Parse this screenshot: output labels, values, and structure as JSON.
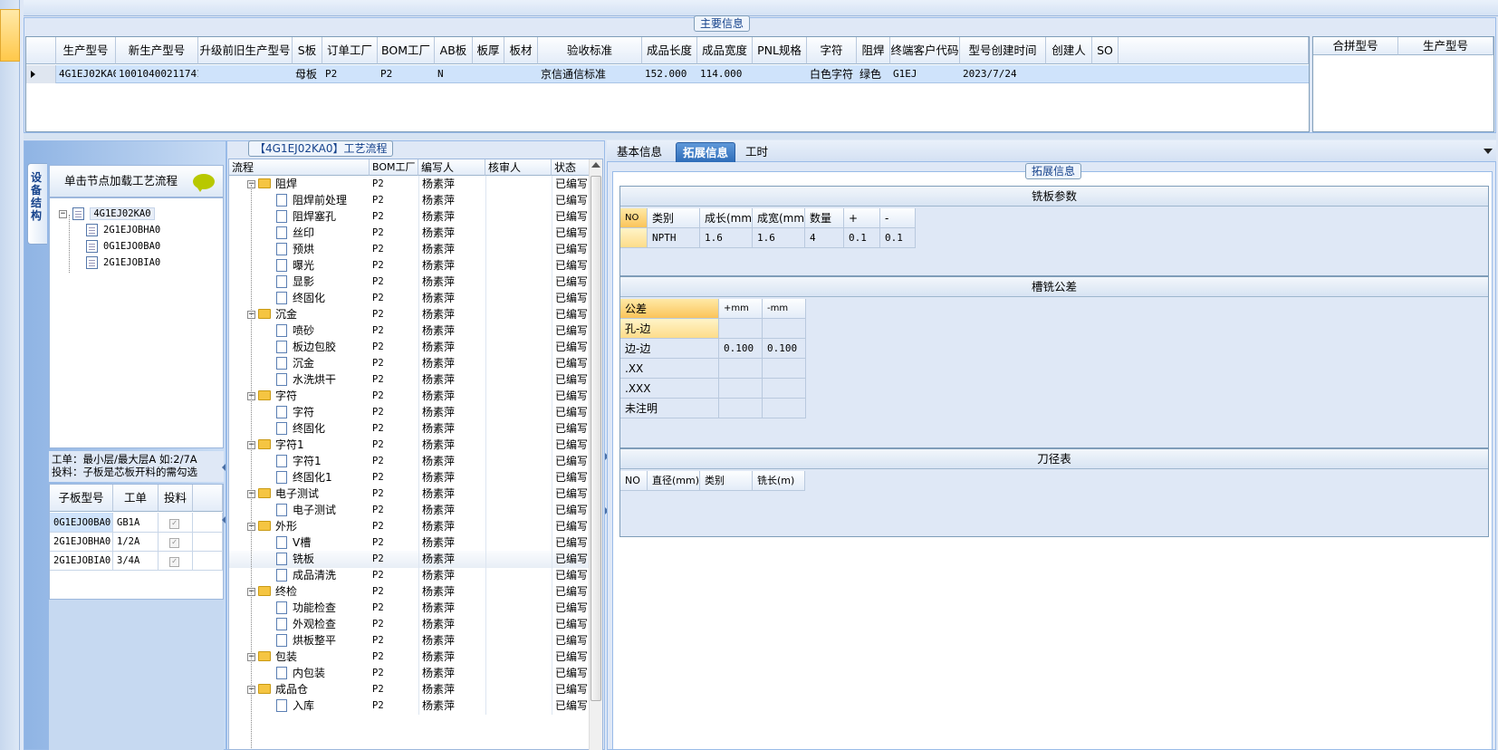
{
  "main_info": {
    "title": "主要信息",
    "columns": [
      "生产型号",
      "新生产型号",
      "升级前旧生产型号",
      "S板",
      "订单工厂",
      "BOM工厂",
      "AB板",
      "板厚",
      "板材",
      "验收标准",
      "成品长度",
      "成品宽度",
      "PNL规格",
      "字符",
      "阻焊",
      "终端客户代码",
      "型号创建时间",
      "创建人",
      "SO"
    ],
    "row": {
      "生产型号": "4G1EJ02KA0",
      "新生产型号": "10010400211741",
      "升级前旧生产型号": "",
      "S板": "母板",
      "订单工厂": "P2",
      "BOM工厂": "P2",
      "AB板": "N",
      "板厚": "",
      "板材": "",
      "验收标准": "京信通信标准",
      "成品长度": "152.000",
      "成品宽度": "114.000",
      "PNL规格": "",
      "字符": "白色字符",
      "阻焊": "绿色",
      "终端客户代码": "G1EJ",
      "型号创建时间": "2023/7/24",
      "创建人": "",
      "SO": ""
    },
    "right_columns": [
      "合拼型号",
      "生产型号"
    ]
  },
  "process_panel": {
    "title": "【4G1EJ02KA0】工艺流程",
    "vertical_tab": "设备结构",
    "tree_header": "单击节点加载工艺流程",
    "tree": {
      "root": "4G1EJ02KA0",
      "children": [
        "2G1EJOBHA0",
        "0G1EJO0BA0",
        "2G1EJOBIA0"
      ]
    },
    "notes": [
      "工单：最小层/最大层A 如:2/7A",
      "投料：子板是芯板开料的需勾选"
    ],
    "sub_columns": [
      "子板型号",
      "工单",
      "投料"
    ],
    "sub_rows": [
      {
        "model": "0G1EJO0BA0",
        "order": "GB1A",
        "feed": "✓"
      },
      {
        "model": "2G1EJOBHA0",
        "order": "1/2A",
        "feed": "✓"
      },
      {
        "model": "2G1EJOBIA0",
        "order": "3/4A",
        "feed": "✓"
      }
    ],
    "flow_columns": [
      "流程",
      "BOM工厂",
      "编写人",
      "核审人",
      "状态"
    ],
    "flow_rows": [
      {
        "name": "阻焊",
        "folder": true,
        "bom": "P2",
        "writer": "杨素萍",
        "status": "已编写"
      },
      {
        "name": "阻焊前处理",
        "folder": false,
        "bom": "P2",
        "writer": "杨素萍",
        "status": "已编写"
      },
      {
        "name": "阻焊塞孔",
        "folder": false,
        "bom": "P2",
        "writer": "杨素萍",
        "status": "已编写"
      },
      {
        "name": "丝印",
        "folder": false,
        "bom": "P2",
        "writer": "杨素萍",
        "status": "已编写"
      },
      {
        "name": "预烘",
        "folder": false,
        "bom": "P2",
        "writer": "杨素萍",
        "status": "已编写"
      },
      {
        "name": "曝光",
        "folder": false,
        "bom": "P2",
        "writer": "杨素萍",
        "status": "已编写"
      },
      {
        "name": "显影",
        "folder": false,
        "bom": "P2",
        "writer": "杨素萍",
        "status": "已编写"
      },
      {
        "name": "终固化",
        "folder": false,
        "bom": "P2",
        "writer": "杨素萍",
        "status": "已编写"
      },
      {
        "name": "沉金",
        "folder": true,
        "bom": "P2",
        "writer": "杨素萍",
        "status": "已编写"
      },
      {
        "name": "喷砂",
        "folder": false,
        "bom": "P2",
        "writer": "杨素萍",
        "status": "已编写"
      },
      {
        "name": "板边包胶",
        "folder": false,
        "bom": "P2",
        "writer": "杨素萍",
        "status": "已编写"
      },
      {
        "name": "沉金",
        "folder": false,
        "bom": "P2",
        "writer": "杨素萍",
        "status": "已编写"
      },
      {
        "name": "水洗烘干",
        "folder": false,
        "bom": "P2",
        "writer": "杨素萍",
        "status": "已编写"
      },
      {
        "name": "字符",
        "folder": true,
        "bom": "P2",
        "writer": "杨素萍",
        "status": "已编写"
      },
      {
        "name": "字符",
        "folder": false,
        "bom": "P2",
        "writer": "杨素萍",
        "status": "已编写"
      },
      {
        "name": "终固化",
        "folder": false,
        "bom": "P2",
        "writer": "杨素萍",
        "status": "已编写"
      },
      {
        "name": "字符1",
        "folder": true,
        "bom": "P2",
        "writer": "杨素萍",
        "status": "已编写"
      },
      {
        "name": "字符1",
        "folder": false,
        "bom": "P2",
        "writer": "杨素萍",
        "status": "已编写"
      },
      {
        "name": "终固化1",
        "folder": false,
        "bom": "P2",
        "writer": "杨素萍",
        "status": "已编写"
      },
      {
        "name": "电子测试",
        "folder": true,
        "bom": "P2",
        "writer": "杨素萍",
        "status": "已编写"
      },
      {
        "name": "电子测试",
        "folder": false,
        "bom": "P2",
        "writer": "杨素萍",
        "status": "已编写"
      },
      {
        "name": "外形",
        "folder": true,
        "bom": "P2",
        "writer": "杨素萍",
        "status": "已编写"
      },
      {
        "name": "V槽",
        "folder": false,
        "bom": "P2",
        "writer": "杨素萍",
        "status": "已编写"
      },
      {
        "name": "铣板",
        "folder": false,
        "bom": "P2",
        "writer": "杨素萍",
        "status": "已编写",
        "selected": true
      },
      {
        "name": "成品清洗",
        "folder": false,
        "bom": "P2",
        "writer": "杨素萍",
        "status": "已编写"
      },
      {
        "name": "终检",
        "folder": true,
        "bom": "P2",
        "writer": "杨素萍",
        "status": "已编写"
      },
      {
        "name": "功能检查",
        "folder": false,
        "bom": "P2",
        "writer": "杨素萍",
        "status": "已编写"
      },
      {
        "name": "外观检查",
        "folder": false,
        "bom": "P2",
        "writer": "杨素萍",
        "status": "已编写"
      },
      {
        "name": "烘板整平",
        "folder": false,
        "bom": "P2",
        "writer": "杨素萍",
        "status": "已编写"
      },
      {
        "name": "包装",
        "folder": true,
        "bom": "P2",
        "writer": "杨素萍",
        "status": "已编写"
      },
      {
        "name": "内包装",
        "folder": false,
        "bom": "P2",
        "writer": "杨素萍",
        "status": "已编写"
      },
      {
        "name": "成品仓",
        "folder": true,
        "bom": "P2",
        "writer": "杨素萍",
        "status": "已编写"
      },
      {
        "name": "入库",
        "folder": false,
        "bom": "P2",
        "writer": "杨素萍",
        "status": "已编写"
      }
    ]
  },
  "tabs": [
    "基本信息",
    "拓展信息",
    "工时"
  ],
  "active_tab": "拓展信息",
  "ext": {
    "title": "拓展信息",
    "mill_params": {
      "title": "铣板参数",
      "columns": [
        "NO",
        "类别",
        "成长(mm)",
        "成宽(mm)",
        "数量",
        "+",
        "-"
      ],
      "rows": [
        [
          "",
          "NPTH",
          "1.6",
          "1.6",
          "4",
          "0.1",
          "0.1"
        ]
      ]
    },
    "slot_tolerance": {
      "title": "槽铣公差",
      "columns": [
        "公差",
        "+mm",
        "-mm"
      ],
      "rows": [
        [
          "孔-边",
          "",
          ""
        ],
        [
          "边-边",
          "0.100",
          "0.100"
        ],
        [
          ".XX",
          "",
          ""
        ],
        [
          ".XXX",
          "",
          ""
        ],
        [
          "未注明",
          "",
          ""
        ]
      ]
    },
    "tool_table": {
      "title": "刀径表",
      "columns": [
        "NO",
        "直径(mm)",
        "类别",
        "铣长(m)"
      ]
    }
  }
}
